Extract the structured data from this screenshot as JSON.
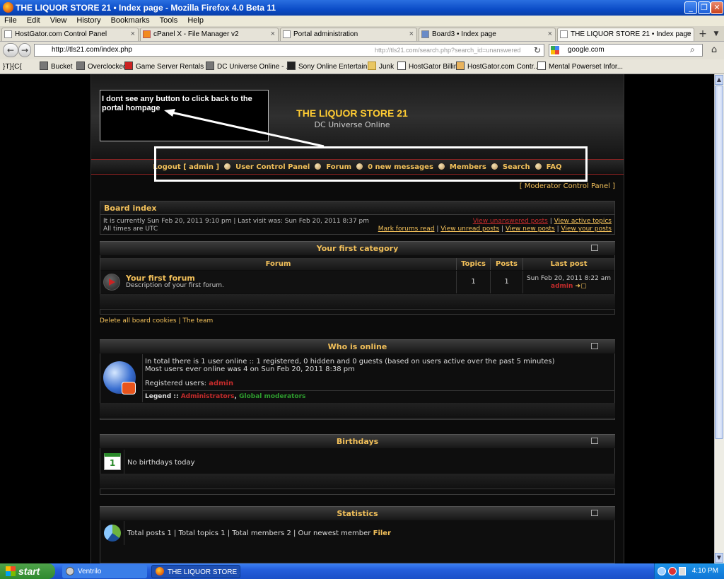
{
  "window": {
    "title": "THE LIQUOR STORE 21 • Index page - Mozilla Firefox 4.0 Beta 11"
  },
  "menu": [
    "File",
    "Edit",
    "View",
    "History",
    "Bookmarks",
    "Tools",
    "Help"
  ],
  "tabs": [
    {
      "label": "HostGator.com Control Panel"
    },
    {
      "label": "cPanel X - File Manager v2"
    },
    {
      "label": "Portal administration"
    },
    {
      "label": "Board3 • Index page"
    },
    {
      "label": "THE LIQUOR STORE 21 • Index page"
    }
  ],
  "nav": {
    "url": "http://tls21.com/index.php",
    "url_hint": "http://tls21.com/search.php?search_id=unanswered",
    "search": "google.com"
  },
  "bookmarks": [
    "}T}{C{",
    "Bucket",
    "Overclocked",
    "Game Server Rentals ...",
    "DC Universe Online - ...",
    "Sony Online Entertain...",
    "Junk",
    "HostGator Billing",
    "HostGator.com Contr...",
    "Mental Powerset Infor..."
  ],
  "site": {
    "title": "THE LIQUOR STORE 21",
    "description": "DC Universe Online"
  },
  "annotation": {
    "text": "I dont see any button to click back to the portal  hompage"
  },
  "navlinks": {
    "logout": "Logout [ admin ]",
    "ucp": "User Control Panel",
    "forum": "Forum",
    "messages": "0 new messages",
    "members": "Members",
    "search": "Search",
    "faq": "FAQ"
  },
  "mcp": "[ Moderator Control Panel ]",
  "board": {
    "title": "Board index",
    "current_time": "It is currently Sun Feb 20, 2011 9:10 pm | Last visit was: Sun Feb 20, 2011 8:37 pm",
    "timezone": "All times are UTC",
    "view_unanswered": "View unanswered posts",
    "view_active": "View active topics",
    "mark_read": "Mark forums read",
    "view_unread": "View unread posts",
    "view_new": "View new posts",
    "view_yours": "View your posts",
    "sep": "|"
  },
  "category": {
    "title": "Your first category",
    "columns": {
      "forum": "Forum",
      "topics": "Topics",
      "posts": "Posts",
      "last": "Last post"
    },
    "forum": {
      "name": "Your first forum",
      "description": "Description of your first forum.",
      "topics": "1",
      "posts": "1",
      "last_date": "Sun Feb 20, 2011 8:22 am",
      "last_user": "admin"
    }
  },
  "footer_links": {
    "delete_cookies": "Delete all board cookies",
    "sep": "|",
    "team": "The team"
  },
  "online": {
    "title": "Who is online",
    "line1": "In total there is 1 user online :: 1 registered, 0 hidden and 0 guests (based on users active over the past 5 minutes)",
    "line2": "Most users ever online was 4 on Sun Feb 20, 2011 8:38 pm",
    "registered_label": "Registered users:",
    "registered_user": "admin",
    "legend_label": "Legend ::",
    "legend_admins": "Administrators",
    "legend_comma": ",",
    "legend_mods": "Global moderators"
  },
  "birthdays": {
    "title": "Birthdays",
    "text": "No birthdays today",
    "calendar_day": "1"
  },
  "stats": {
    "title": "Statistics",
    "text": "Total posts 1 | Total topics 1 | Total members 2 | Our newest member",
    "newest": "Filer"
  },
  "taskbar": {
    "start": "start",
    "tasks": [
      "Ventrilo",
      "THE LIQUOR STORE ..."
    ],
    "clock": "4:10 PM"
  }
}
